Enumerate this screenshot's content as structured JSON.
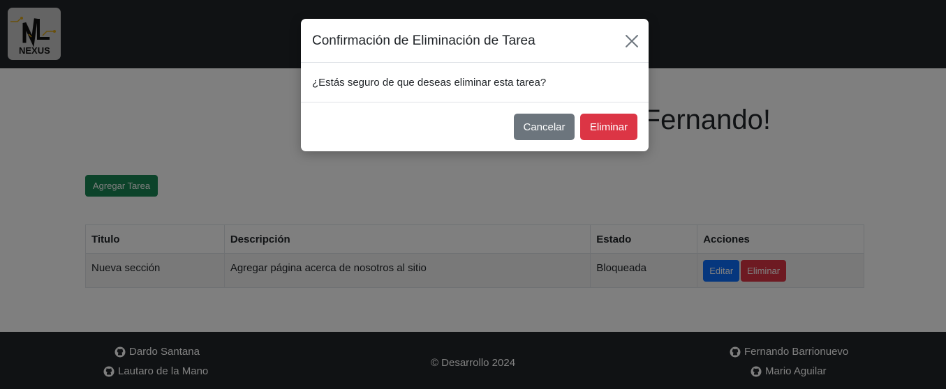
{
  "brand": {
    "logo_text": "NEXUS"
  },
  "main": {
    "welcome_title": "¡Bienvenido, Fernando!",
    "add_task_button": "Agregar Tarea"
  },
  "table": {
    "headers": [
      "Titulo",
      "Descripción",
      "Estado",
      "Acciones"
    ],
    "rows": [
      {
        "title": "Nueva sección",
        "description": "Agregar página acerca de nosotros al sitio",
        "status": "Bloqueada",
        "edit_label": "Editar",
        "delete_label": "Eliminar"
      }
    ]
  },
  "footer": {
    "left_links": [
      "Dardo Santana",
      "Lautaro de la Mano"
    ],
    "copyright": "© Desarrollo 2024",
    "right_links": [
      "Fernando Barrionuevo",
      "Mario Aguilar"
    ],
    "icon": "github-icon"
  },
  "modal": {
    "title": "Confirmación de Eliminación de Tarea",
    "message": "¿Estás seguro de que deseas eliminar esta tarea?",
    "cancel_label": "Cancelar",
    "confirm_label": "Eliminar",
    "close_icon": "close-icon"
  },
  "colors": {
    "dark": "#212529",
    "success": "#198754",
    "primary": "#0d6efd",
    "danger": "#dc3545",
    "secondary": "#6c757d"
  }
}
